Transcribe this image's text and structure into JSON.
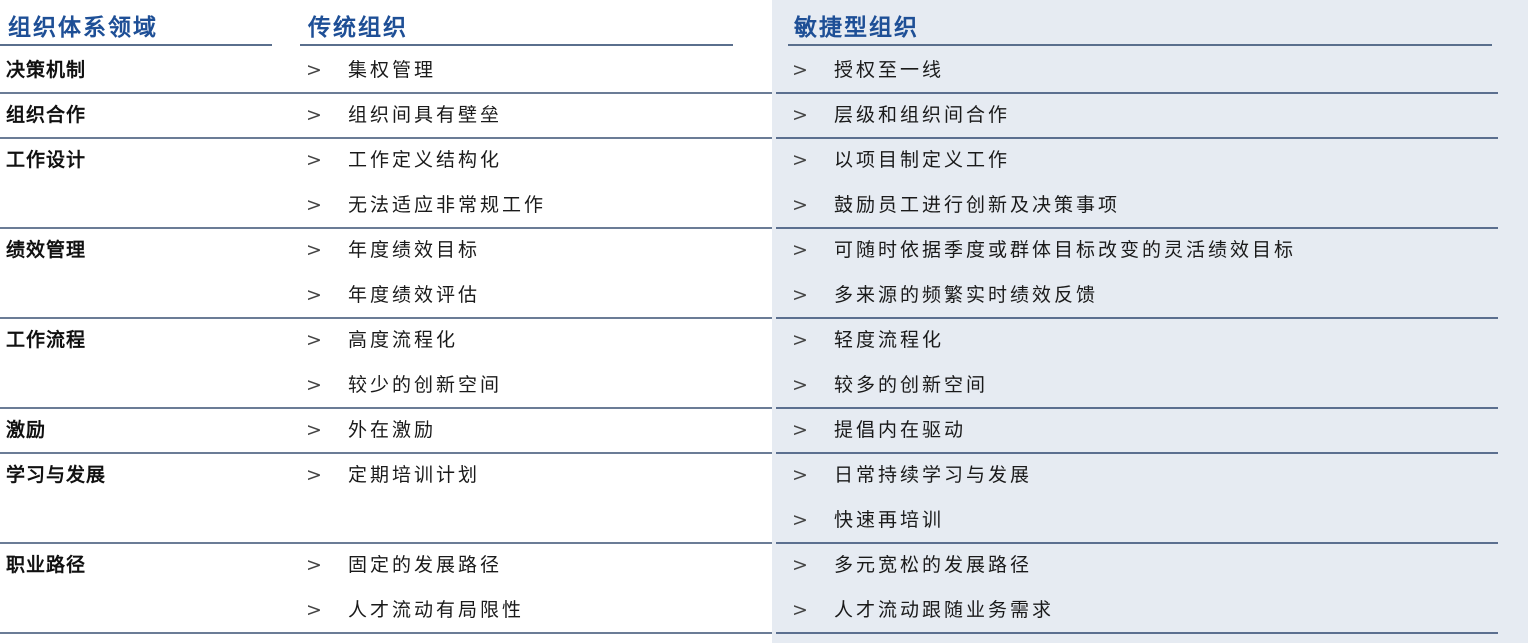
{
  "headers": {
    "domain": "组织体系领域",
    "traditional": "传统组织",
    "agile": "敏捷型组织"
  },
  "marker": ">",
  "rows": [
    {
      "category": "决策机制",
      "traditional": [
        "集权管理"
      ],
      "agile": [
        "授权至一线"
      ]
    },
    {
      "category": "组织合作",
      "traditional": [
        "组织间具有壁垒"
      ],
      "agile": [
        "层级和组织间合作"
      ]
    },
    {
      "category": "工作设计",
      "traditional": [
        "工作定义结构化",
        "无法适应非常规工作"
      ],
      "agile": [
        "以项目制定义工作",
        "鼓励员工进行创新及决策事项"
      ]
    },
    {
      "category": "绩效管理",
      "traditional": [
        "年度绩效目标",
        "年度绩效评估"
      ],
      "agile": [
        "可随时依据季度或群体目标改变的灵活绩效目标",
        "多来源的频繁实时绩效反馈"
      ]
    },
    {
      "category": "工作流程",
      "traditional": [
        "高度流程化",
        "较少的创新空间"
      ],
      "agile": [
        "轻度流程化",
        "较多的创新空间"
      ]
    },
    {
      "category": "激励",
      "traditional": [
        "外在激励"
      ],
      "agile": [
        "提倡内在驱动"
      ]
    },
    {
      "category": "学习与发展",
      "traditional": [
        "定期培训计划"
      ],
      "agile": [
        "日常持续学习与发展",
        "快速再培训"
      ]
    },
    {
      "category": "职业路径",
      "traditional": [
        "固定的发展路径",
        "人才流动有局限性"
      ],
      "agile": [
        "多元宽松的发展路径",
        "人才流动跟随业务需求"
      ]
    }
  ]
}
